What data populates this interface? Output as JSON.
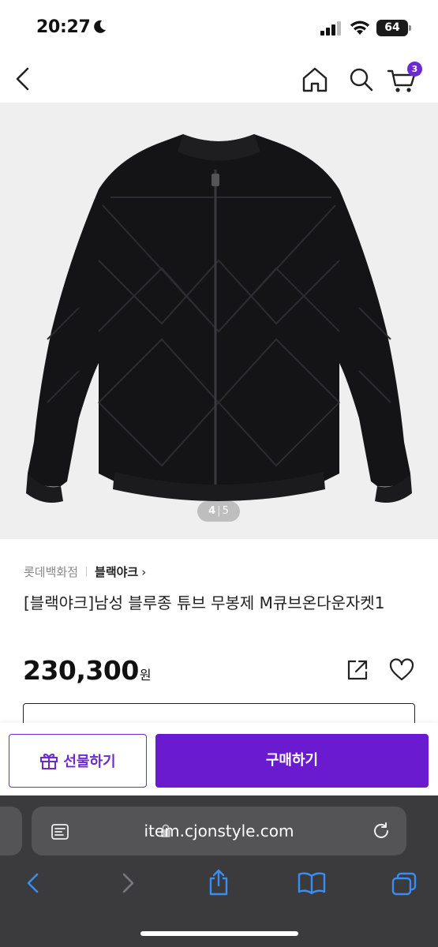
{
  "status_bar": {
    "time": "20:27",
    "battery": "64"
  },
  "header": {
    "cart_count": "3"
  },
  "gallery": {
    "current": "4",
    "separator": "|",
    "total": "5"
  },
  "product": {
    "store": "롯데백화점",
    "brand": "블랙야크",
    "brand_chevron": "›",
    "title": "[블랙야크]남성 블루종 튜브 무봉제 M큐브온다운자켓1",
    "price": "230,300",
    "currency": "원"
  },
  "actions": {
    "gift_label": "선물하기",
    "buy_label": "구매하기"
  },
  "browser": {
    "url": "item.cjonstyle.com"
  },
  "icons": {
    "back": "chevron-left-icon",
    "home": "home-icon",
    "search": "search-icon",
    "cart": "cart-icon",
    "share": "share-icon",
    "like": "heart-icon",
    "gift": "gift-icon",
    "reader": "reader-icon",
    "lock": "lock-icon",
    "reload": "reload-icon",
    "browser_back": "back-icon",
    "browser_forward": "forward-icon",
    "browser_share": "share-icon",
    "bookmarks": "book-icon",
    "tabs": "tabs-icon"
  },
  "colors": {
    "accent": "#6a1bd0",
    "badge": "#6b2bd1",
    "safari_bg": "#3b3b3d",
    "safari_blue": "#3a8df2"
  }
}
